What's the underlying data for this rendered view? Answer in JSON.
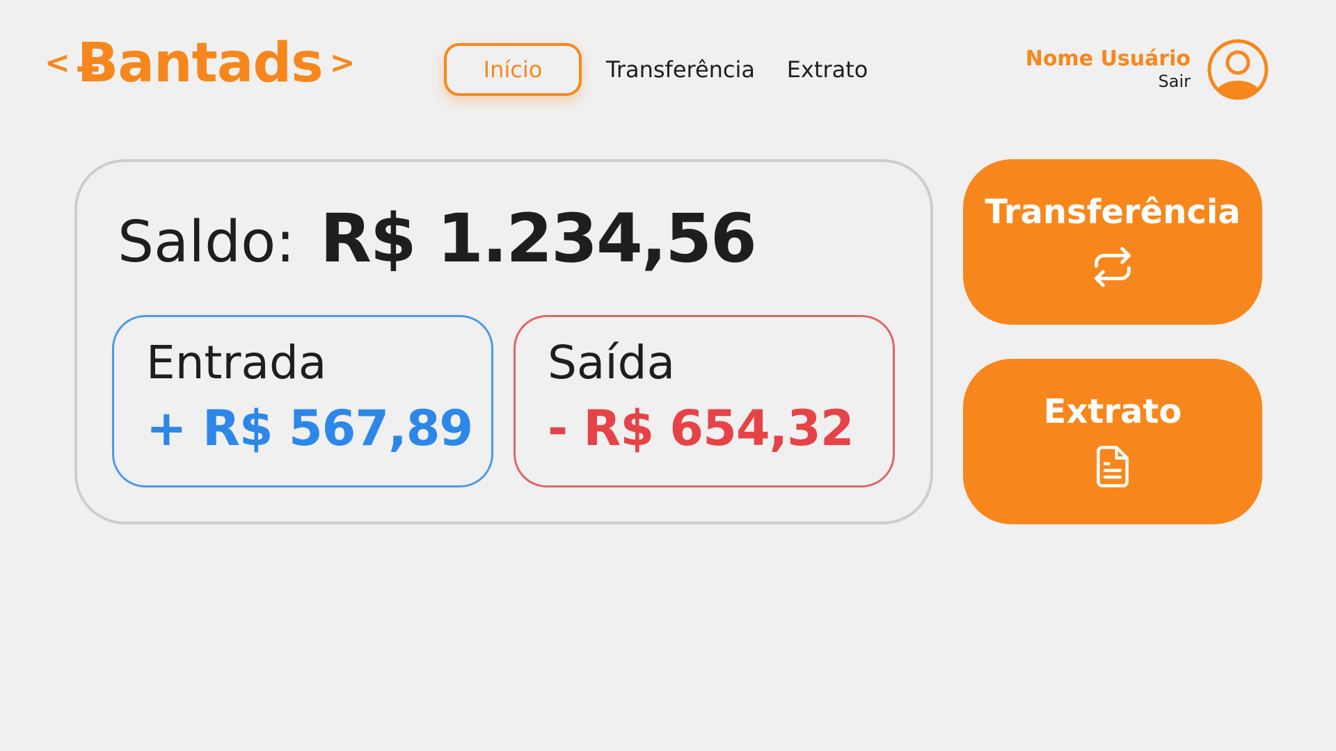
{
  "brand": {
    "open_bracket": "<",
    "name": "Ƀantads",
    "close_bracket": ">",
    "color": "#f7871c"
  },
  "nav": {
    "items": [
      {
        "label": "Início",
        "active": true
      },
      {
        "label": "Transferência",
        "active": false
      },
      {
        "label": "Extrato",
        "active": false
      }
    ]
  },
  "user": {
    "name": "Nome Usuário",
    "logout_label": "Sair",
    "avatar_icon": "user-circle-icon"
  },
  "balance": {
    "label": "Saldo:",
    "value": "R$ 1.234,56"
  },
  "income": {
    "title": "Entrada",
    "value": "+ R$ 567,89",
    "color": "#2c87e8"
  },
  "expense": {
    "title": "Saída",
    "value": "- R$ 654,32",
    "color": "#e54347"
  },
  "actions": {
    "transfer": {
      "label": "Transferência",
      "icon": "swap-arrows-icon"
    },
    "statement": {
      "label": "Extrato",
      "icon": "document-icon"
    }
  },
  "colors": {
    "accent": "#f7871c",
    "background": "#f0f0f0",
    "text": "#1e1e1e"
  }
}
